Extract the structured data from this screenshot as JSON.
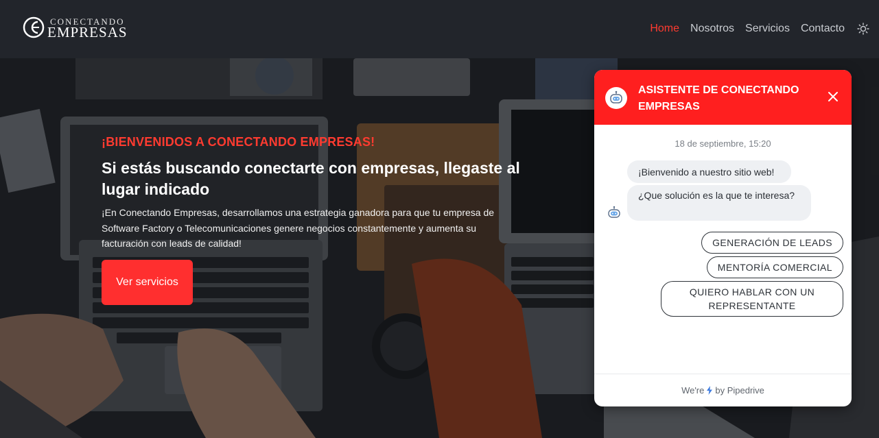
{
  "header": {
    "logo": {
      "line1": "CONECTANDO",
      "line2": "EMPRESAS"
    },
    "nav": [
      {
        "label": "Home",
        "active": true
      },
      {
        "label": "Nosotros",
        "active": false
      },
      {
        "label": "Servicios",
        "active": false
      },
      {
        "label": "Contacto",
        "active": false
      }
    ],
    "theme_toggle_icon": "sun-icon"
  },
  "hero": {
    "kicker": "¡BIENVENIDOS A CONECTANDO EMPRESAS!",
    "title": "Si estás buscando conectarte con empresas, llegaste al lugar indicado",
    "text": "¡En Conectando Empresas, desarrollamos una estrategia ganadora para que tu empresa de Software Factory o Telecomunicaciones genere negocios constantemente y aumenta su facturación con leads de calidad!",
    "button": "Ver servicios"
  },
  "chat": {
    "title": "ASISTENTE DE CONECTANDO EMPRESAS",
    "date": "18 de septiembre, 15:20",
    "messages": [
      "¡Bienvenido a nuestro sitio web!",
      "¿Que solución es la que te interesa?"
    ],
    "options": [
      "GENERACIÓN DE LEADS",
      "MENTORÍA COMERCIAL",
      "QUIERO HABLAR CON UN REPRESENTANTE"
    ],
    "footer": {
      "prefix": "We're",
      "suffix": "by Pipedrive"
    }
  },
  "colors": {
    "accent": "#ff2f2f",
    "header_bg": "#22252b",
    "nav_text": "#c9ccd1"
  }
}
